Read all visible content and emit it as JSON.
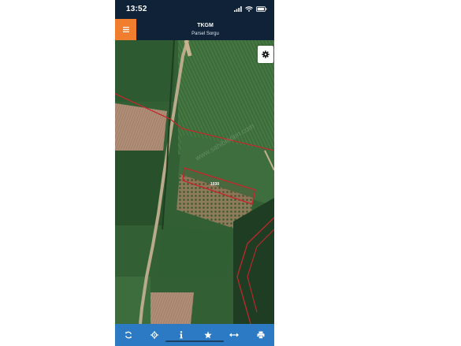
{
  "status_bar": {
    "time": "13:52",
    "icons": [
      "signal-icon",
      "wifi-icon",
      "battery-icon"
    ]
  },
  "header": {
    "title": "TKGM",
    "subtitle": "Parsel Sorgu",
    "menu_icon": "hamburger-menu-icon",
    "accent_color": "#f07e2e",
    "bar_color": "#0f2237"
  },
  "map": {
    "parcel_label": "1030",
    "watermark": "www.sahibinden.com",
    "boundary_color": "#c0282d",
    "settings_icon": "gear-icon"
  },
  "toolbar": {
    "color": "#2c79c4",
    "items": [
      {
        "icon": "refresh-icon"
      },
      {
        "icon": "locate-icon"
      },
      {
        "icon": "info-icon"
      },
      {
        "icon": "star-icon"
      },
      {
        "icon": "measure-icon"
      },
      {
        "icon": "print-icon"
      }
    ]
  }
}
